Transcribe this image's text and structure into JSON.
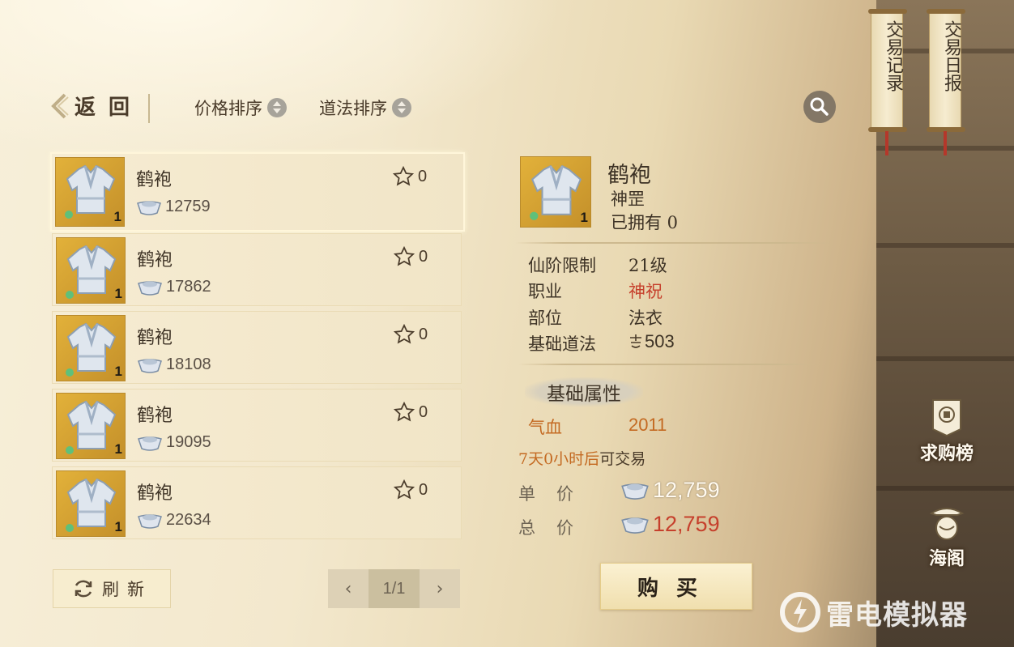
{
  "header": {
    "back_label": "返回",
    "sort_price_label": "价格排序",
    "sort_dao_label": "道法排序"
  },
  "listings": [
    {
      "name": "鹤袍",
      "price": "12759",
      "favorites": "0",
      "quantity": "1"
    },
    {
      "name": "鹤袍",
      "price": "17862",
      "favorites": "0",
      "quantity": "1"
    },
    {
      "name": "鹤袍",
      "price": "18108",
      "favorites": "0",
      "quantity": "1"
    },
    {
      "name": "鹤袍",
      "price": "19095",
      "favorites": "0",
      "quantity": "1"
    },
    {
      "name": "鹤袍",
      "price": "22634",
      "favorites": "0",
      "quantity": "1"
    }
  ],
  "footer": {
    "refresh_label": "刷新",
    "page": "1/1"
  },
  "detail": {
    "name": "鹤袍",
    "class_name": "神罡",
    "owned": "已拥有 0",
    "quantity": "1",
    "attributes": [
      {
        "label": "仙阶限制",
        "value": "21级"
      },
      {
        "label": "职业",
        "value": "神祝"
      },
      {
        "label": "部位",
        "value": "法衣"
      },
      {
        "label": "基础道法",
        "value": "503"
      }
    ],
    "section_title": "基础属性",
    "stat": {
      "label": "气血",
      "value": "2011"
    },
    "trade_time": "7天0小时后",
    "trade_suffix": "可交易",
    "unit_price_label": "单价",
    "unit_price": "12,759",
    "total_price_label": "总价",
    "total_price": "12,759",
    "buy_label": "购买"
  },
  "side": {
    "trade_record": "交易记录",
    "trade_daily": "交易日报",
    "wanted_board": "求购榜",
    "sea_pavilion": "海阁"
  },
  "watermark": "雷电模拟器",
  "colors": {
    "highlight_red": "#c6402c",
    "stat_orange": "#c46a22"
  }
}
